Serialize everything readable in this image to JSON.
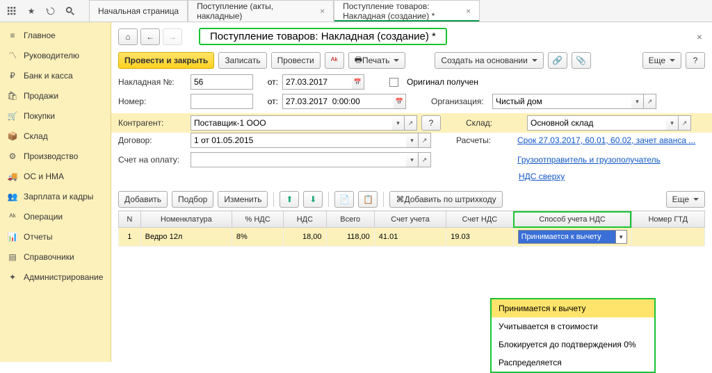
{
  "topbar": {
    "tabs": [
      "Начальная страница",
      "Поступление (акты, накладные)",
      "Поступление товаров: Накладная (создание) *"
    ]
  },
  "sidebar": {
    "items": [
      {
        "label": "Главное",
        "icon": "menu"
      },
      {
        "label": "Руководителю",
        "icon": "chart"
      },
      {
        "label": "Банк и касса",
        "icon": "ruble"
      },
      {
        "label": "Продажи",
        "icon": "bag"
      },
      {
        "label": "Покупки",
        "icon": "cart"
      },
      {
        "label": "Склад",
        "icon": "box"
      },
      {
        "label": "Производство",
        "icon": "gear"
      },
      {
        "label": "ОС и НМА",
        "icon": "truck"
      },
      {
        "label": "Зарплата и кадры",
        "icon": "people"
      },
      {
        "label": "Операции",
        "icon": "ops"
      },
      {
        "label": "Отчеты",
        "icon": "report"
      },
      {
        "label": "Справочники",
        "icon": "book"
      },
      {
        "label": "Администрирование",
        "icon": "wrench"
      }
    ]
  },
  "header": {
    "title": "Поступление товаров: Накладная (создание) *"
  },
  "toolbar": {
    "post_close": "Провести и закрыть",
    "save": "Записать",
    "post": "Провести",
    "print": "Печать",
    "create_based": "Создать на основании",
    "more": "Еще"
  },
  "form": {
    "invoice_no_label": "Накладная №:",
    "invoice_no": "56",
    "from": "от:",
    "date1": "27.03.2017",
    "number_label": "Номер:",
    "number": "",
    "date2": "27.03.2017  0:00:00",
    "original_received": "Оригинал получен",
    "org_label": "Организация:",
    "org": "Чистый дом",
    "contractor_label": "Контрагент:",
    "contractor": "Поставщик-1 ООО",
    "help": "?",
    "warehouse_label": "Склад:",
    "warehouse": "Основной склад",
    "contract_label": "Договор:",
    "contract": "1 от 01.05.2015",
    "calc_label": "Расчеты:",
    "calc_link": "Срок 27.03.2017, 60.01, 60.02, зачет аванса ...",
    "invoice_pay_label": "Счет на оплату:",
    "invoice_pay": "",
    "consignor_link": "Грузоотправитель и грузополучатель",
    "vat_link": "НДС сверху"
  },
  "tbl_toolbar": {
    "add": "Добавить",
    "select": "Подбор",
    "edit": "Изменить",
    "barcode": "Добавить по штрихкоду",
    "more": "Еще"
  },
  "grid": {
    "headers": [
      "N",
      "Номенклатура",
      "% НДС",
      "НДС",
      "Всего",
      "Счет учета",
      "Счет НДС",
      "Способ учета НДС",
      "Номер ГТД"
    ],
    "row": {
      "n": "1",
      "nom": "Ведро 12л",
      "vat_pct": "8%",
      "vat": "18,00",
      "total": "118,00",
      "acct": "41.01",
      "acct_vat": "19.03",
      "method": "Принимается к вычету",
      "gtd": ""
    }
  },
  "dropdown": {
    "options": [
      "Принимается к вычету",
      "Учитывается в стоимости",
      "Блокируется до подтверждения 0%",
      "Распределяется"
    ]
  }
}
